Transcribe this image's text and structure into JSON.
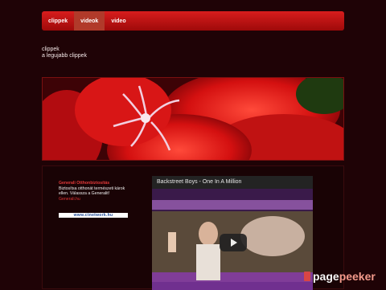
{
  "nav": {
    "items": [
      {
        "label": "clippek"
      },
      {
        "label": "videok"
      },
      {
        "label": "video"
      }
    ],
    "active_index": 1
  },
  "intro": {
    "site_name": "clippek",
    "tagline": "a legujabb clippek"
  },
  "ad": {
    "title": "Generali Otthonbiztosítás",
    "body": "Biztosítsa otthonát természeti károk ellen. Válassza a Generalit!",
    "link": "Generali.hu",
    "url_badge": "www.ctnetwork.hu"
  },
  "video": {
    "title": "Backstreet Boys - One In A Million"
  },
  "watermark": {
    "part1": "page",
    "part2": "peeker"
  },
  "colors": {
    "nav_red": "#c41616",
    "background": "#1f0306",
    "ad_title": "#e23a3a"
  }
}
